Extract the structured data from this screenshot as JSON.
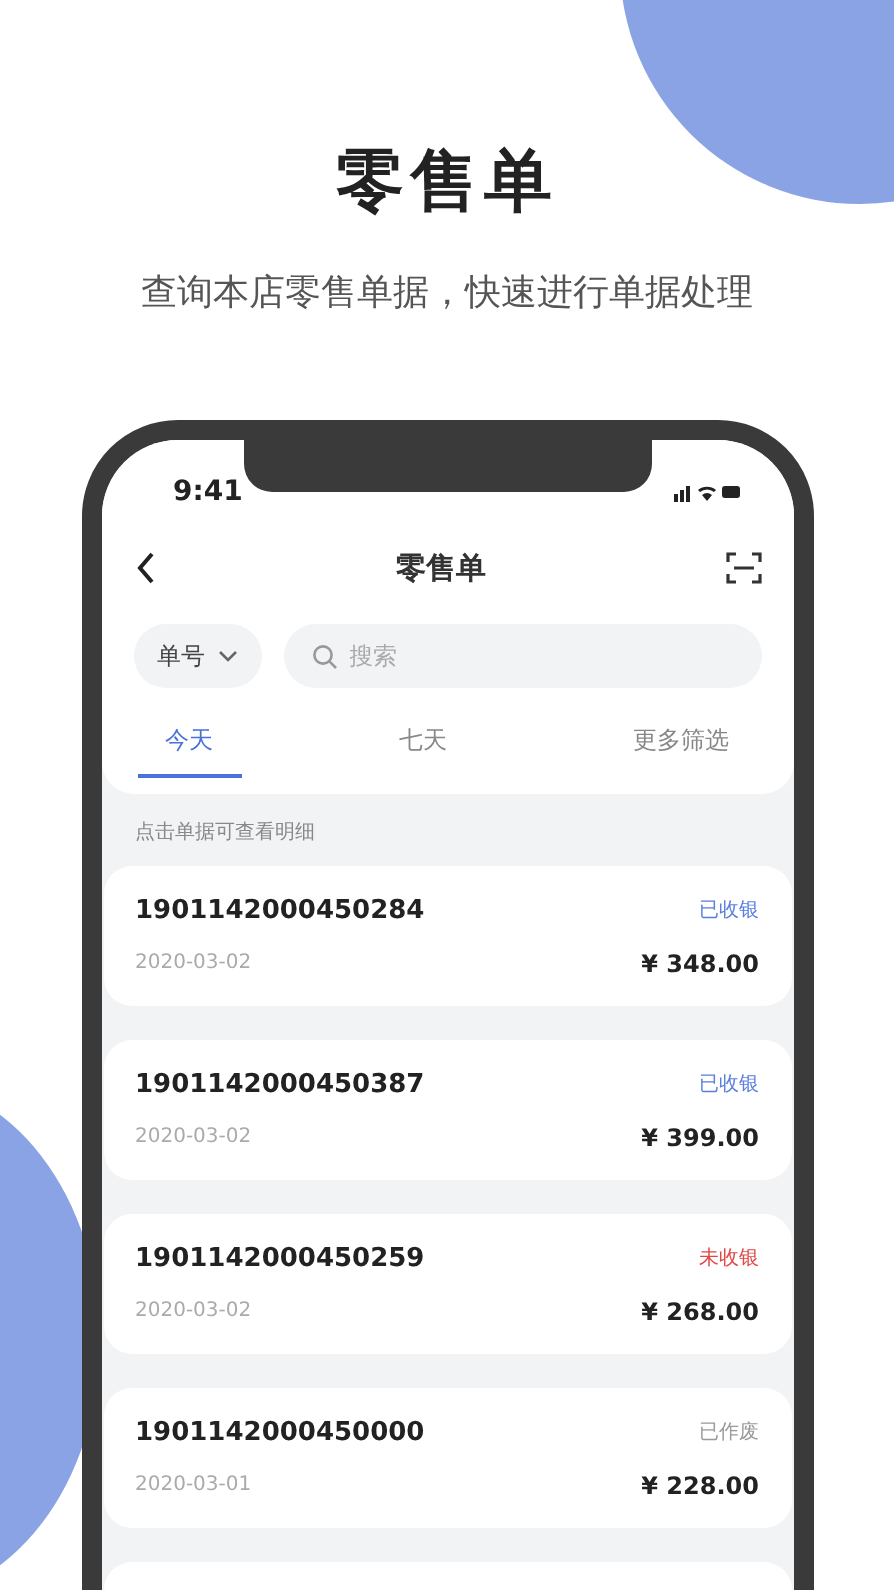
{
  "headline": "零售单",
  "subtitle": "查询本店零售单据，快速进行单据处理",
  "status_bar": {
    "time": "9:41"
  },
  "nav": {
    "title": "零售单"
  },
  "search": {
    "filter": "单号",
    "placeholder": "搜索"
  },
  "tabs": [
    {
      "label": "今天",
      "selected": true
    },
    {
      "label": "七天",
      "selected": false
    },
    {
      "label": "更多筛选",
      "selected": false
    }
  ],
  "hint": "点击单据可查看明细",
  "orders": [
    {
      "number": "1901142000450284",
      "status": "已收银",
      "color": "#5b7fe0",
      "date": "2020-03-02",
      "amount": "¥ 348.00"
    },
    {
      "number": "1901142000450387",
      "status": "已收银",
      "color": "#5b7fe0",
      "date": "2020-03-02",
      "amount": "¥ 399.00"
    },
    {
      "number": "1901142000450259",
      "status": "未收银",
      "color": "#e04848",
      "date": "2020-03-02",
      "amount": "¥ 268.00"
    },
    {
      "number": "1901142000450000",
      "status": "已作废",
      "color": "#9a9a9a",
      "date": "2020-03-01",
      "amount": "¥ 228.00"
    }
  ]
}
